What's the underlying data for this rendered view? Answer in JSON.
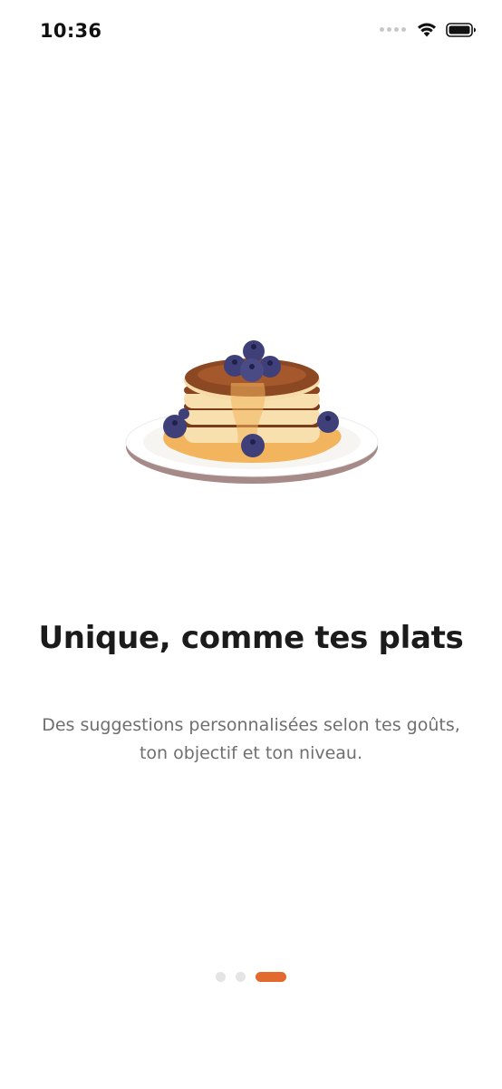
{
  "status_bar": {
    "time": "10:36",
    "icons": [
      "cellular-signal-icon",
      "wifi-icon",
      "battery-icon"
    ]
  },
  "onboarding": {
    "illustration": "pancake-stack-illustration",
    "title": "Unique, comme tes plats",
    "description": "Des suggestions personnalisées selon tes goûts, ton objectif et ton niveau."
  },
  "pager": {
    "total_pages": 3,
    "current_page": 3
  },
  "colors": {
    "accent": "#e36a2e",
    "inactive_dot": "#e4e4e4",
    "title": "#1b1b1b",
    "body_text": "#6f6f6f",
    "background": "#ffffff"
  }
}
